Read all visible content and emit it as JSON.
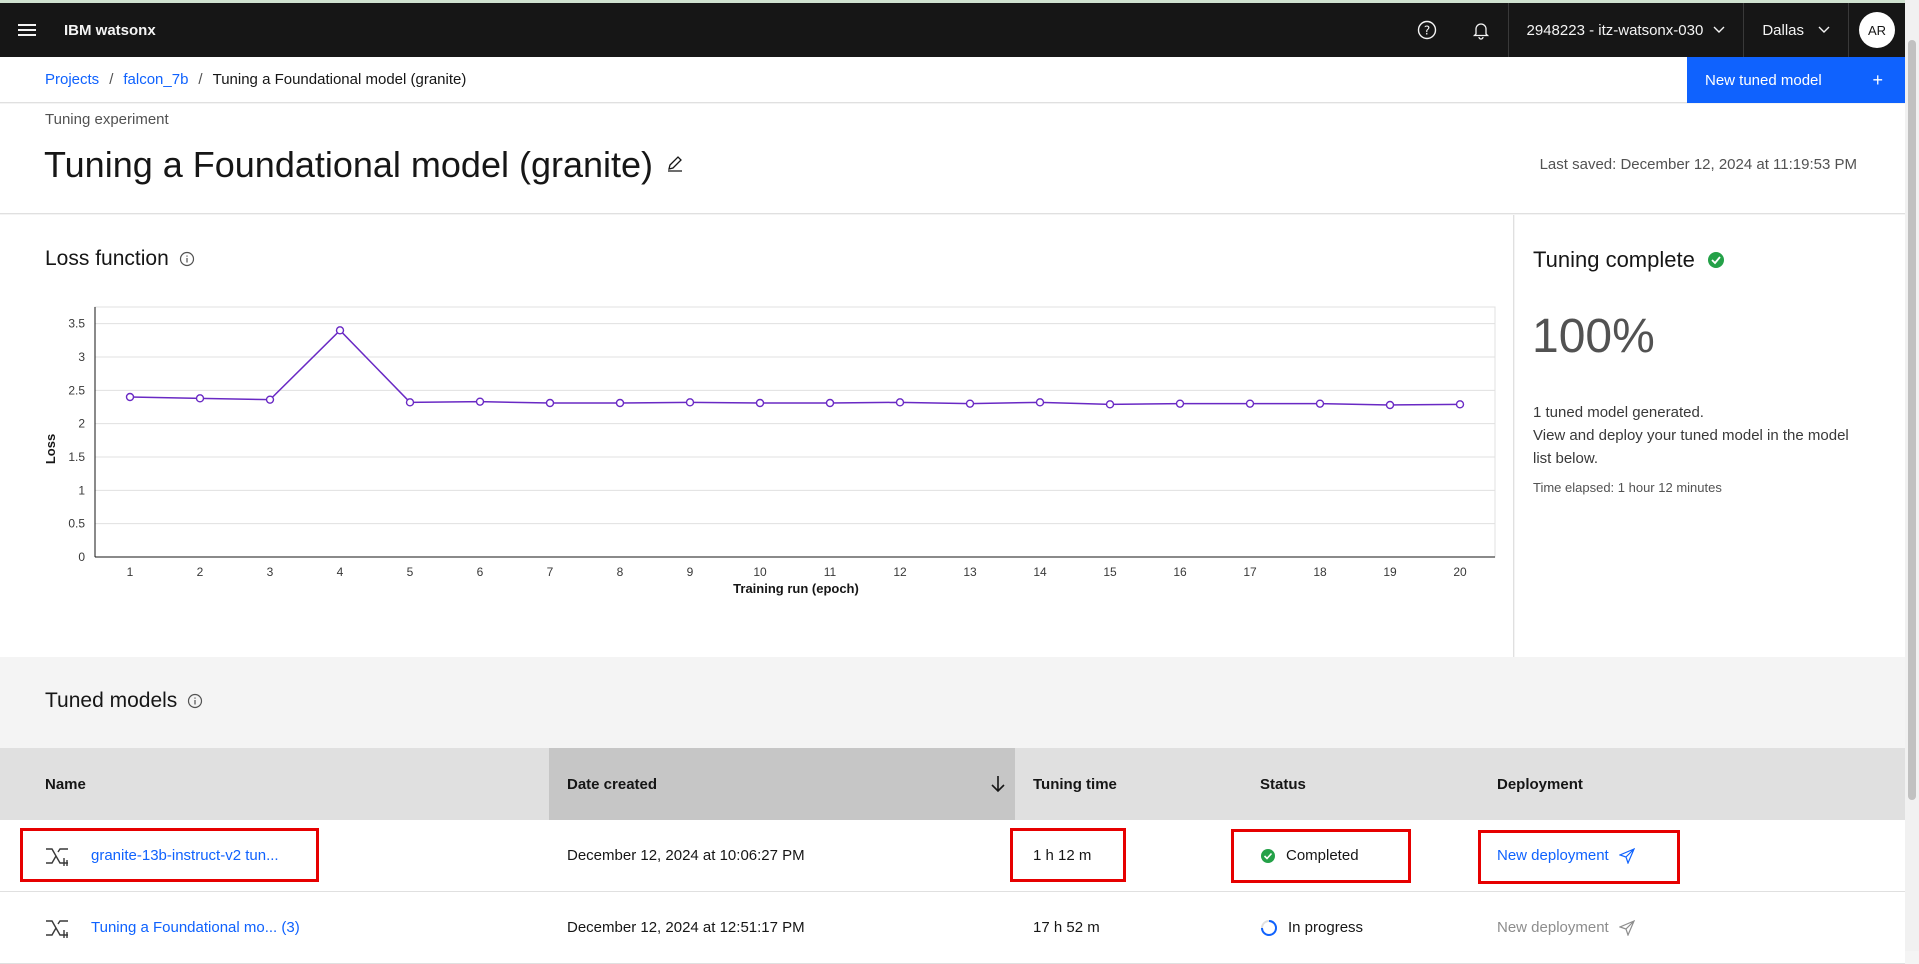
{
  "topbar": {
    "brand_bold": "IBM",
    "brand_name": "watsonx",
    "account": "2948223 - itz-watsonx-030",
    "region": "Dallas",
    "avatar": "AR"
  },
  "breadcrumb": {
    "items": [
      "Projects",
      "falcon_7b",
      "Tuning a Foundational model (granite)"
    ],
    "sep": "/"
  },
  "actions": {
    "new_tuned_model": "New tuned model",
    "plus": "+"
  },
  "header": {
    "subtitle": "Tuning experiment",
    "title": "Tuning a Foundational model (granite)",
    "last_saved": "Last saved: December 12, 2024 at 11:19:53 PM"
  },
  "loss": {
    "title": "Loss function"
  },
  "chart_data": {
    "type": "line",
    "title": "",
    "xlabel": "Training run (epoch)",
    "ylabel": "Loss",
    "x": [
      1,
      2,
      3,
      4,
      5,
      6,
      7,
      8,
      9,
      10,
      11,
      12,
      13,
      14,
      15,
      16,
      17,
      18,
      19,
      20
    ],
    "ylim": [
      0,
      3.75
    ],
    "yticks": [
      "0",
      "0.5",
      "1",
      "1.5",
      "2",
      "2.5",
      "3",
      "3.5"
    ],
    "series": [
      {
        "values": [
          2.4,
          2.38,
          2.36,
          3.4,
          2.32,
          2.33,
          2.31,
          2.31,
          2.32,
          2.31,
          2.31,
          2.32,
          2.3,
          2.32,
          2.29,
          2.3,
          2.3,
          2.3,
          2.28,
          2.29
        ],
        "color": "#6929c4"
      }
    ],
    "grid": true
  },
  "tuning": {
    "title": "Tuning complete",
    "percent": "100%",
    "msg1": "1 tuned model generated.",
    "msg2": "View and deploy your tuned model in the model list below.",
    "elapsed": "Time elapsed: 1 hour 12 minutes"
  },
  "tuned_models": {
    "title": "Tuned models",
    "headers": {
      "name": "Name",
      "date": "Date created",
      "time": "Tuning time",
      "status": "Status",
      "deployment": "Deployment"
    },
    "rows": [
      {
        "name": "granite-13b-instruct-v2 tun...",
        "date": "December 12, 2024 at 10:06:27 PM",
        "time": "1 h 12 m",
        "status": "Completed",
        "deployment": "New deployment"
      },
      {
        "name": "Tuning a Foundational mo... (3)",
        "date": "December 12, 2024 at 12:51:17 PM",
        "time": "17 h 52 m",
        "status": "In progress",
        "deployment": "New deployment"
      }
    ]
  },
  "colors": {
    "accent": "#0f62fe",
    "success": "#24a148",
    "highlight": "#e60000"
  }
}
